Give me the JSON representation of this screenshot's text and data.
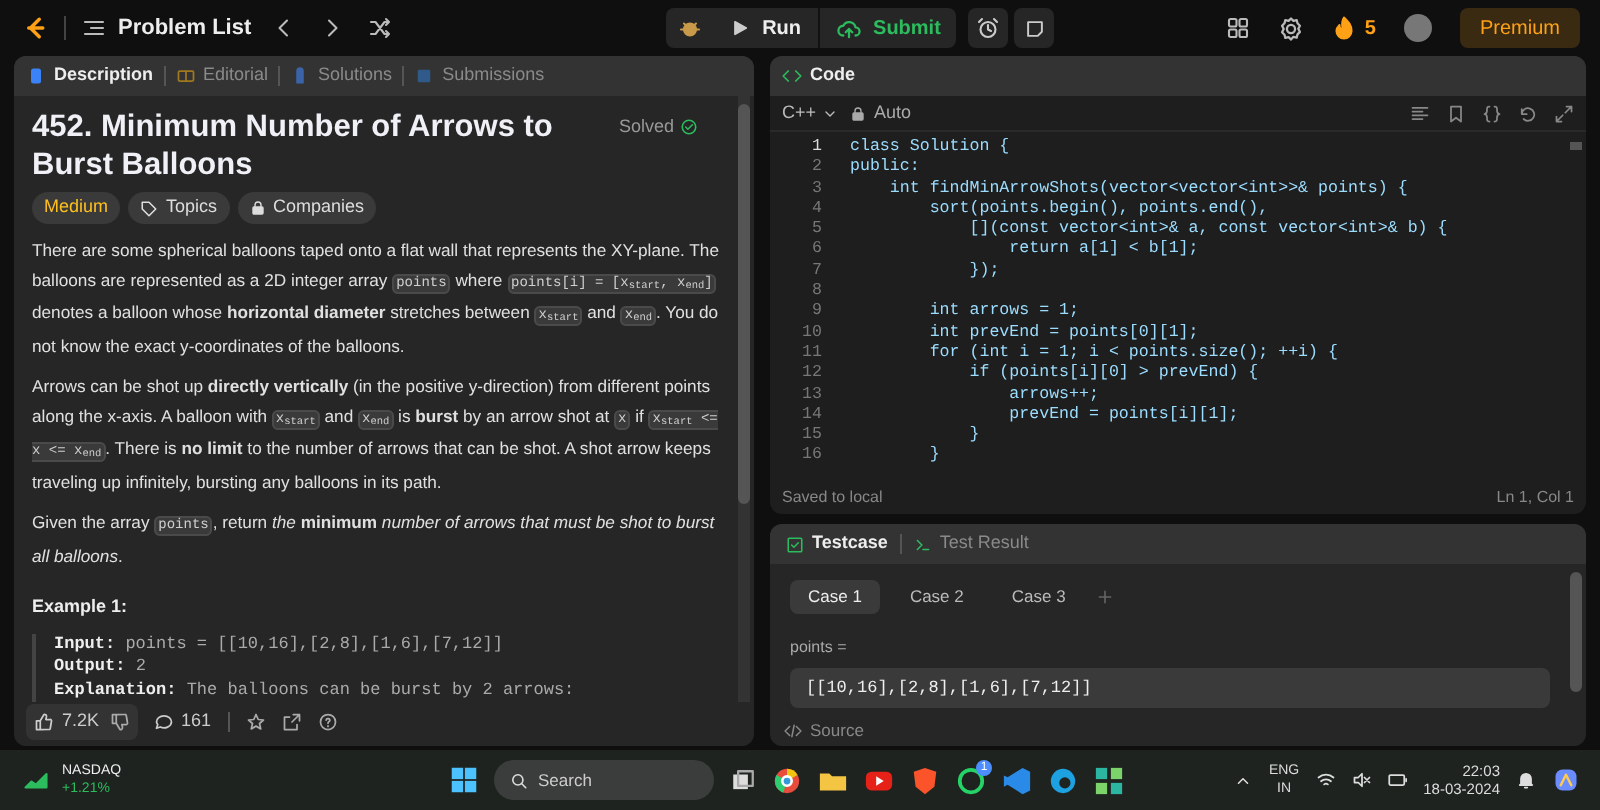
{
  "top_bar": {
    "nav_label": "Problem List",
    "run": "Run",
    "submit": "Submit",
    "streak": "5",
    "premium": "Premium"
  },
  "description_panel": {
    "tabs": [
      {
        "label": "Description",
        "selected": true
      },
      {
        "label": "Editorial",
        "selected": false
      },
      {
        "label": "Solutions",
        "selected": false
      },
      {
        "label": "Submissions",
        "selected": false
      }
    ],
    "title": "452. Minimum Number of Arrows to Burst Balloons",
    "status": "Solved",
    "tags": [
      {
        "label": "Medium",
        "kind": "difficulty"
      },
      {
        "label": "Topics",
        "kind": "topics"
      },
      {
        "label": "Companies",
        "kind": "companies"
      }
    ],
    "paragraphs": [
      [
        {
          "text": "There are some spherical balloons taped onto a flat wall that represents the XY-plane. The balloons are represented as a 2D integer array ",
          "code": false
        },
        {
          "text": "points",
          "code": true
        },
        {
          "text": " where ",
          "code": false
        },
        {
          "text": "points[i] = [x$_{start}$, x$_{end}$]",
          "code": true
        },
        {
          "text": " denotes a balloon whose **horizontal diameter** stretches between ",
          "code": false
        },
        {
          "text": "x$_{start}$",
          "code": true
        },
        {
          "text": " and ",
          "code": false
        },
        {
          "text": "x$_{end}$",
          "code": true
        },
        {
          "text": ". You do not know the exact y-coordinates of the balloons.",
          "code": false
        }
      ],
      [
        {
          "text": "Arrows can be shot up **directly vertically** (in the positive y-direction) from different points along the x-axis. A balloon with ",
          "code": false
        },
        {
          "text": "x$_{start}$",
          "code": true
        },
        {
          "text": " and ",
          "code": false
        },
        {
          "text": "x$_{end}$",
          "code": true
        },
        {
          "text": " is **burst** by an arrow shot at ",
          "code": false
        },
        {
          "text": "x",
          "code": true
        },
        {
          "text": " if ",
          "code": false
        },
        {
          "text": "x$_{start}$ <= x <= x$_{end}$",
          "code": true
        },
        {
          "text": ". There is **no limit** to the number of arrows that can be shot. A shot arrow keeps traveling up infinitely, bursting any balloons in its path.",
          "code": false
        }
      ],
      [
        {
          "text": "Given the array ",
          "code": false
        },
        {
          "text": "points",
          "code": true
        },
        {
          "text": ", return *the* **minimum** *number of arrows that must be shot to burst all balloons*.",
          "code": false
        }
      ]
    ],
    "example": {
      "heading": "Example 1:",
      "lines": [
        {
          "label": "Input:",
          "value": "points = [[10,16],[2,8],[1,6],[7,12]]"
        },
        {
          "label": "Output:",
          "value": "2"
        },
        {
          "label": "Explanation:",
          "value": "The balloons can be burst by 2 arrows:"
        }
      ]
    },
    "actions": {
      "likes": "7.2K",
      "comments": "161"
    }
  },
  "code_panel": {
    "title": "Code",
    "language": "C++",
    "mode": "Auto",
    "lines": [
      {
        "number": "1",
        "text": "class Solution {"
      },
      {
        "number": "2",
        "text": "public:"
      },
      {
        "number": "3",
        "text": "    int findMinArrowShots(vector<vector<int>>& points) {"
      },
      {
        "number": "4",
        "text": "        sort(points.begin(), points.end(),"
      },
      {
        "number": "5",
        "text": "            [](const vector<int>& a, const vector<int>& b) {"
      },
      {
        "number": "6",
        "text": "                return a[1] < b[1];"
      },
      {
        "number": "7",
        "text": "            });"
      },
      {
        "number": "8"
      },
      {
        "number": "9",
        "text": "        int arrows = 1;"
      },
      {
        "number": "10",
        "text": "        int prevEnd = points[0][1];"
      },
      {
        "number": "11",
        "text": "        for (int i = 1; i < points.size(); ++i) {"
      },
      {
        "number": "12",
        "text": "            if (points[i][0] > prevEnd) {"
      },
      {
        "number": "13",
        "text": "                arrows++;"
      },
      {
        "number": "14",
        "text": "                prevEnd = points[i][1];"
      },
      {
        "number": "15",
        "text": "            }"
      },
      {
        "number": "16",
        "text": "        }"
      }
    ],
    "save_status": "Saved to local",
    "cursor": "Ln 1, Col 1"
  },
  "testcase_panel": {
    "tabs": [
      {
        "label": "Testcase",
        "selected": true
      },
      {
        "label": "Test Result",
        "selected": false
      }
    ],
    "cases": [
      {
        "label": "Case 1",
        "selected": true
      },
      {
        "label": "Case 2",
        "selected": false
      },
      {
        "label": "Case 3",
        "selected": false
      }
    ],
    "param_label": "points =",
    "param_value": "[[10,16],[2,8],[1,6],[7,12]]",
    "source": "Source"
  },
  "taskbar": {
    "widget_title": "NASDAQ",
    "widget_value": "+1.21%",
    "search_placeholder": "Search",
    "chat_badge": "1",
    "language": "ENG",
    "region": "IN",
    "time": "22:03",
    "date": "18-03-2024"
  }
}
